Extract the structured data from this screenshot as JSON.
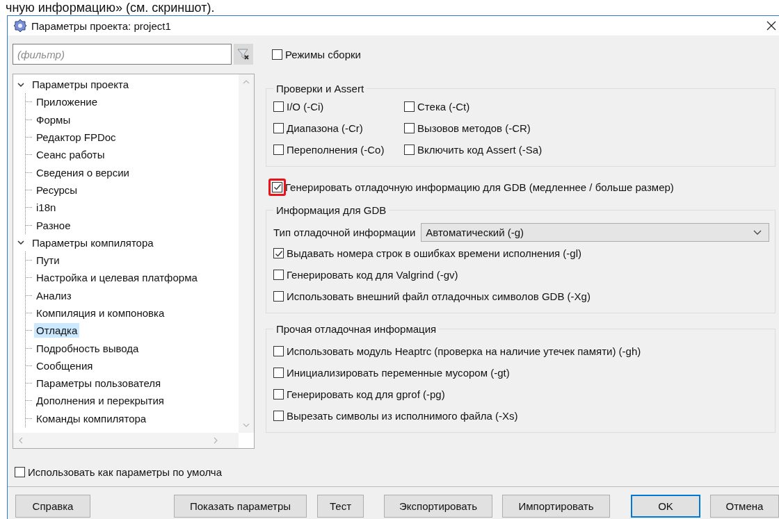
{
  "caption_fragment": "чную информацию» (см. скриншот).",
  "window": {
    "title": "Параметры проекта: project1"
  },
  "filter": {
    "placeholder": "(фильтр)"
  },
  "tree": [
    {
      "label": "Параметры проекта",
      "expanded": true,
      "selected": false,
      "children": [
        {
          "label": "Приложение",
          "selected": false
        },
        {
          "label": "Формы",
          "selected": false
        },
        {
          "label": "Редактор FPDoc",
          "selected": false
        },
        {
          "label": "Сеанс работы",
          "selected": false
        },
        {
          "label": "Сведения о версии",
          "selected": false
        },
        {
          "label": "Ресурсы",
          "selected": false
        },
        {
          "label": "i18n",
          "selected": false
        },
        {
          "label": "Разное",
          "selected": false
        }
      ]
    },
    {
      "label": "Параметры компилятора",
      "expanded": true,
      "selected": false,
      "children": [
        {
          "label": "Пути",
          "selected": false
        },
        {
          "label": "Настройка и целевая платформа",
          "selected": false
        },
        {
          "label": "Анализ",
          "selected": false
        },
        {
          "label": "Компиляция и компоновка",
          "selected": false
        },
        {
          "label": "Отладка",
          "selected": true
        },
        {
          "label": "Подробность вывода",
          "selected": false
        },
        {
          "label": "Сообщения",
          "selected": false
        },
        {
          "label": "Параметры пользователя",
          "selected": false
        },
        {
          "label": "Дополнения и перекрытия",
          "selected": false
        },
        {
          "label": "Команды компилятора",
          "selected": false
        }
      ]
    }
  ],
  "use_as_default": {
    "label": "Использовать как параметры по умолча",
    "checked": false
  },
  "sections": [
    {
      "kind": "checkbox",
      "label": "Режимы сборки",
      "checked": false,
      "highlighted": false
    },
    {
      "kind": "grid",
      "title": "Проверки и Assert",
      "items": [
        {
          "kind": "checkbox",
          "label": "I/O (-Ci)",
          "checked": false
        },
        {
          "kind": "checkbox",
          "label": "Стека (-Ct)",
          "checked": false
        },
        {
          "kind": "checkbox",
          "label": "Диапазона (-Cr)",
          "checked": false
        },
        {
          "kind": "checkbox",
          "label": "Вызовов методов (-CR)",
          "checked": false
        },
        {
          "kind": "checkbox",
          "label": "Переполнения (-Co)",
          "checked": false
        },
        {
          "kind": "checkbox",
          "label": "Включить код Assert (-Sa)",
          "checked": false
        }
      ]
    },
    {
      "kind": "checkbox",
      "label": "Генерировать отладочную информацию для GDB (медленнее / больше размер)",
      "checked": true,
      "highlighted": true
    },
    {
      "kind": "group",
      "title": "Информация для GDB",
      "items": [
        {
          "kind": "select",
          "label": "Тип отладочной информации",
          "value": "Автоматический (-g)"
        },
        {
          "kind": "checkbox",
          "label": "Выдавать номера строк в ошибках времени исполнения (-gl)",
          "checked": true
        },
        {
          "kind": "checkbox",
          "label": "Генерировать код для Valgrind (-gv)",
          "checked": false
        },
        {
          "kind": "checkbox",
          "label": "Использовать внешний файл отладочных символов GDB (-Xg)",
          "checked": false
        }
      ]
    },
    {
      "kind": "group",
      "title": "Прочая отладочная информация",
      "items": [
        {
          "kind": "checkbox",
          "label": "Использовать модуль Heaptrc (проверка на наличие утечек памяти) (-gh)",
          "checked": false
        },
        {
          "kind": "checkbox",
          "label": "Инициализировать переменные мусором (-gt)",
          "checked": false
        },
        {
          "kind": "checkbox",
          "label": "Генерировать код для gprof (-pg)",
          "checked": false
        },
        {
          "kind": "checkbox",
          "label": "Вырезать символы из исполнимого файла (-Xs)",
          "checked": false
        }
      ]
    }
  ],
  "buttons": [
    {
      "label": "Справка",
      "default": false
    },
    {
      "label": "Показать параметры",
      "default": false
    },
    {
      "label": "Тест",
      "default": false
    },
    {
      "label": "Экспортировать",
      "default": false
    },
    {
      "label": "Импортировать",
      "default": false
    },
    {
      "label": "OK",
      "default": true
    },
    {
      "label": "Отмена",
      "default": false
    }
  ]
}
